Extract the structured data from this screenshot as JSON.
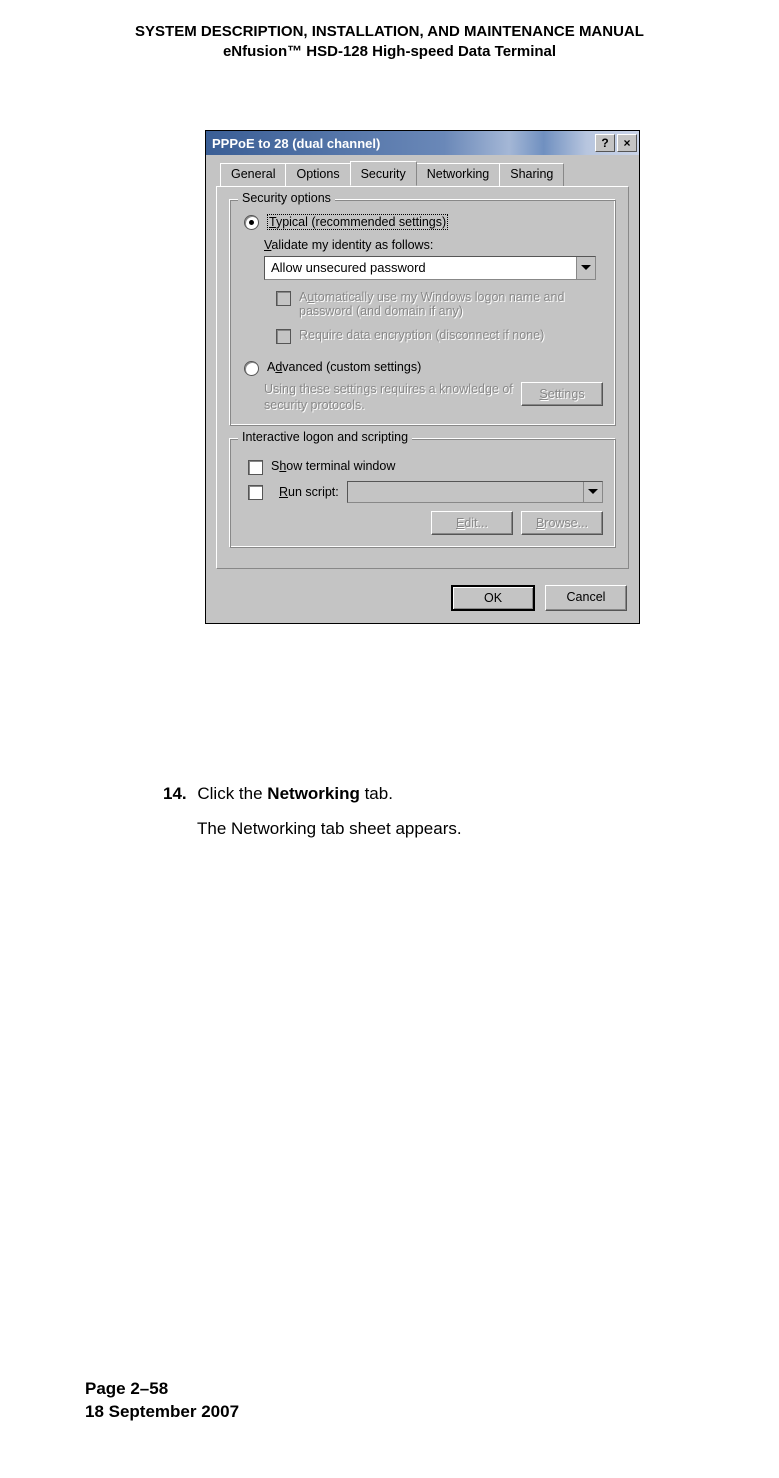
{
  "doc": {
    "header_line1": "SYSTEM DESCRIPTION, INSTALLATION, AND MAINTENANCE MANUAL",
    "header_line2": "eNfusion™ HSD-128 High-speed Data Terminal",
    "footer_page": "Page 2–58",
    "footer_date": "18 September 2007"
  },
  "dialog": {
    "title": "PPPoE to 28 (dual channel)",
    "help_glyph": "?",
    "close_glyph": "×",
    "tabs": {
      "general": "General",
      "options": "Options",
      "security": "Security",
      "networking": "Networking",
      "sharing": "Sharing"
    },
    "security": {
      "group_label": "Security options",
      "typical_prefix": "T",
      "typical_rest": "ypical (recommended settings)",
      "validate_prefix": "V",
      "validate_rest": "alidate my identity as follows:",
      "combo_value": "Allow unsecured password",
      "auto_logon_pre": "A",
      "auto_logon_mid": "u",
      "auto_logon_rest": "tomatically use my Windows logon name and password (and domain if any)",
      "require_enc_pre": "Require data encryption (disconnect if none)",
      "advanced_pre": "A",
      "advanced_mid": "d",
      "advanced_rest": "vanced (custom settings)",
      "advanced_hint": "Using these settings requires a knowledge of security protocols.",
      "settings_btn_pre": "S",
      "settings_btn_rest": "ettings"
    },
    "interactive": {
      "group_label": "Interactive logon and scripting",
      "show_pre": "S",
      "show_mid": "h",
      "show_rest": "ow terminal window",
      "run_pre": "R",
      "run_rest": "un script:",
      "edit_pre": "E",
      "edit_rest": "dit...",
      "browse_pre": "B",
      "browse_rest": "rowse..."
    },
    "footer": {
      "ok": "OK",
      "cancel": "Cancel"
    }
  },
  "instruction": {
    "num": "14.",
    "pre": "Click the ",
    "bold": "Networking",
    "post": " tab.",
    "sub": "The Networking tab sheet appears."
  }
}
